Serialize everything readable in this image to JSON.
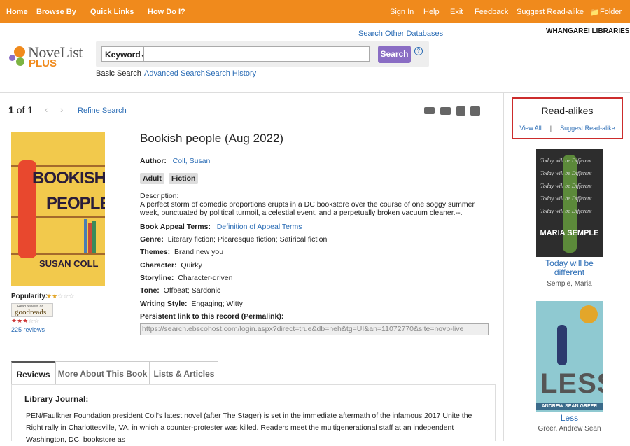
{
  "nav": {
    "home": "Home",
    "browse_by": "Browse By",
    "quick_links": "Quick Links",
    "how_do_i": "How Do I?",
    "sign_in": "Sign In",
    "help": "Help",
    "exit": "Exit",
    "feedback": "Feedback",
    "suggest": "Suggest Read-alike",
    "folder": "Folder"
  },
  "header": {
    "logo_name": "NoveList",
    "logo_plus": "PLUS",
    "search_other": "Search Other Databases",
    "library": "WHANGAREI LIBRARIES",
    "field_select": "Keyword",
    "search_value": "",
    "search_button": "Search",
    "help_icon": "?",
    "basic_search": "Basic Search",
    "advanced_search": "Advanced Search",
    "search_history": "Search History"
  },
  "results": {
    "position": "1",
    "of_label": "of 1",
    "refine": "Refine Search"
  },
  "book": {
    "title": "Bookish people (Aug 2022)",
    "author_label": "Author:",
    "author": "Coll, Susan",
    "badges": [
      "Adult",
      "Fiction"
    ],
    "description_label": "Description:",
    "description": "A perfect storm of comedic proportions erupts in a DC bookstore over the course of one soggy summer week, punctuated by political turmoil, a celestial event, and a perpetually broken vacuum cleaner.--.",
    "appeal_label": "Book Appeal Terms:",
    "appeal_link": "Definition of Appeal Terms",
    "genre_label": "Genre:",
    "genre": "Literary fiction; Picaresque fiction; Satirical fiction",
    "themes_label": "Themes:",
    "themes": "Brand new you",
    "character_label": "Character:",
    "character": "Quirky",
    "storyline_label": "Storyline:",
    "storyline": "Character-driven",
    "tone_label": "Tone:",
    "tone": "Offbeat; Sardonic",
    "writing_label": "Writing Style:",
    "writing": "Engaging; Witty",
    "permalink_label": "Persistent link to this record (Permalink):",
    "permalink": "https://search.ebscohost.com/login.aspx?direct=true&db=neh&tg=UI&an=11072770&site=novp-live",
    "cover_title_1": "BOOKISH",
    "cover_title_2": "PEOPLE",
    "cover_author": "SUSAN COLL",
    "popularity_label": "Popularity:",
    "popularity_stars": 2,
    "goodreads_small": "Read reviews on",
    "goodreads": "goodreads",
    "goodreads_stars": 3,
    "reviews_count": "225 reviews"
  },
  "tabs": [
    {
      "label": "Reviews",
      "active": true
    },
    {
      "label": "More About This Book",
      "active": false
    },
    {
      "label": "Lists & Articles",
      "active": false
    }
  ],
  "review": {
    "source": "Library Journal:",
    "text": "PEN/Faulkner Foundation president Coll's latest novel (after The Stager) is set in the immediate aftermath of the infamous 2017 Unite the Right rally in Charlottesville, VA, in which a counter-protester was killed. Readers meet the multigenerational staff at an independent Washington, DC, bookstore as"
  },
  "readalikes": {
    "title": "Read-alikes",
    "view_all": "View All",
    "suggest": "Suggest Read-alike",
    "items": [
      {
        "title": "Today will be different",
        "author": "Semple, Maria",
        "cover_name": "MARIA SEMPLE",
        "cover_line": "Today will be Different"
      },
      {
        "title": "Less",
        "author": "Greer, Andrew Sean",
        "cover_name": "ANDREW SEAN GREER",
        "cover_line": "LESS"
      }
    ]
  },
  "colors": {
    "nav": "#f08a1c",
    "search_button": "#8a6dc4",
    "link": "#2a6cb5",
    "highlight_border": "#cc2c2c"
  }
}
